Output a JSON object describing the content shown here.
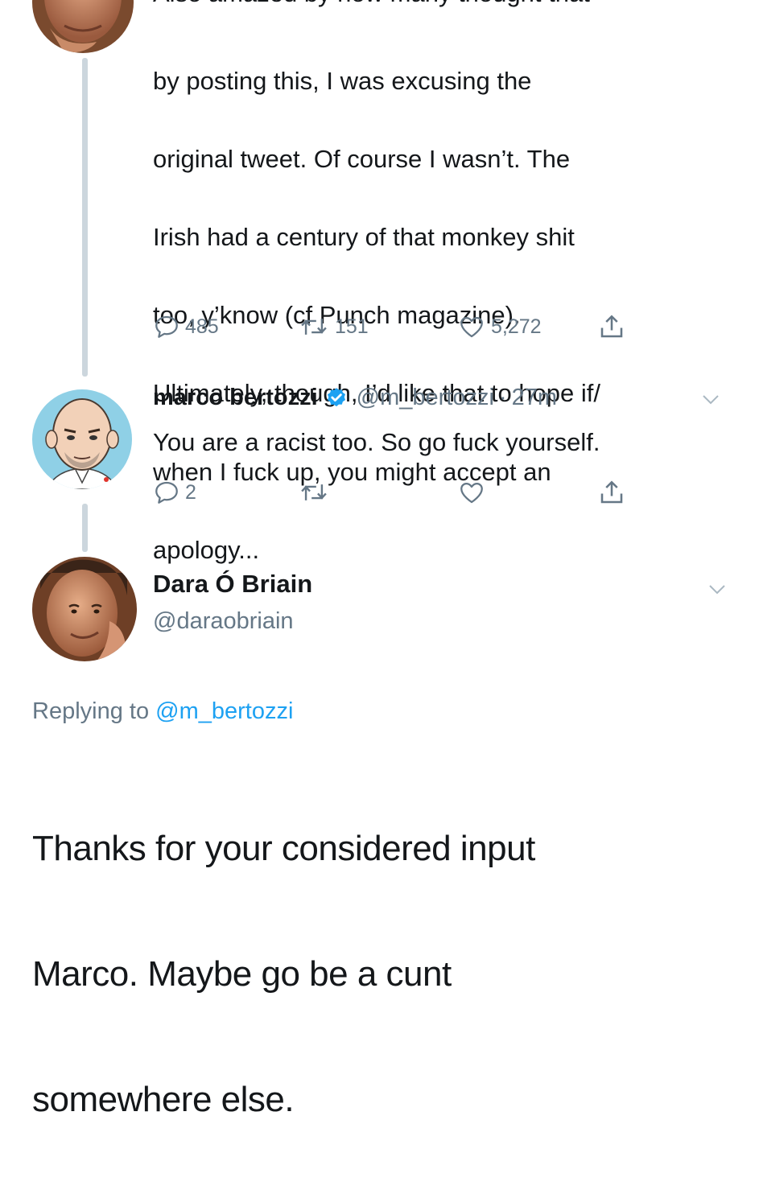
{
  "top_tweet": {
    "clipped_line": "Also amazed by how many thought that",
    "text_lines": [
      "by posting this, I was excusing the",
      "original tweet. Of course I wasn’t. The",
      "Irish had a century of that monkey shit",
      "too, y’know (cf Punch magazine).",
      "Ultimately, though, I’d like that to hope if/",
      "when I fuck up, you might accept an",
      "apology..."
    ],
    "actions": {
      "reply_count": "485",
      "retweet_count": "151",
      "like_count": "5,272"
    }
  },
  "marco_tweet": {
    "display_name": "marco bertozzi",
    "handle": "@m_bertozzi",
    "separator": "·",
    "time": "27m",
    "text": "You are a racist too. So go fuck yourself.",
    "actions": {
      "reply_count": "2"
    }
  },
  "dara_tweet": {
    "display_name": "Dara Ó Briain",
    "handle": "@daraobriain",
    "replying_prefix": "Replying to",
    "replying_handle": "@m_bertozzi",
    "text_lines": [
      "Thanks for your considered input",
      "Marco. Maybe go be a cunt",
      "somewhere else."
    ]
  },
  "colors": {
    "text": "#14171a",
    "secondary": "#657786",
    "accent": "#1da1f2",
    "thread_line": "#ccd6dd"
  },
  "icons": [
    "reply-icon",
    "retweet-icon",
    "like-icon",
    "share-icon",
    "verified-badge-icon",
    "chevron-down-icon"
  ]
}
